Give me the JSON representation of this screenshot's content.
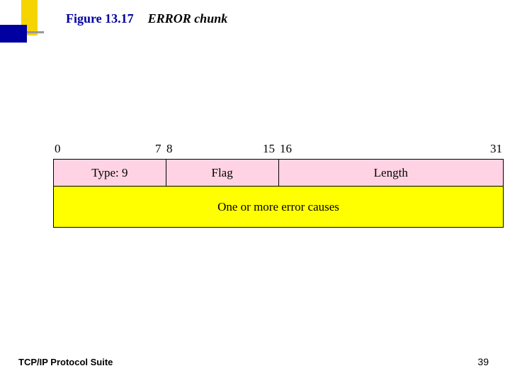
{
  "header": {
    "figure_number": "Figure 13.17",
    "caption": "ERROR chunk"
  },
  "bits": {
    "b0": "0",
    "b7": "7",
    "b8": "8",
    "b15": "15",
    "b16": "16",
    "b31": "31"
  },
  "chart_data": {
    "type": "table",
    "title": "ERROR chunk format",
    "rows": [
      {
        "bits": "0-7",
        "label": "Type: 9",
        "bg": "pink",
        "width_bits": 8
      },
      {
        "bits": "8-15",
        "label": "Flag",
        "bg": "pink",
        "width_bits": 8
      },
      {
        "bits": "16-31",
        "label": "Length",
        "bg": "pink",
        "width_bits": 16
      },
      {
        "bits": "0-31",
        "label": "One or more error causes",
        "bg": "yellow",
        "width_bits": 32
      }
    ]
  },
  "footer": {
    "left": "TCP/IP Protocol Suite",
    "page": "39"
  }
}
